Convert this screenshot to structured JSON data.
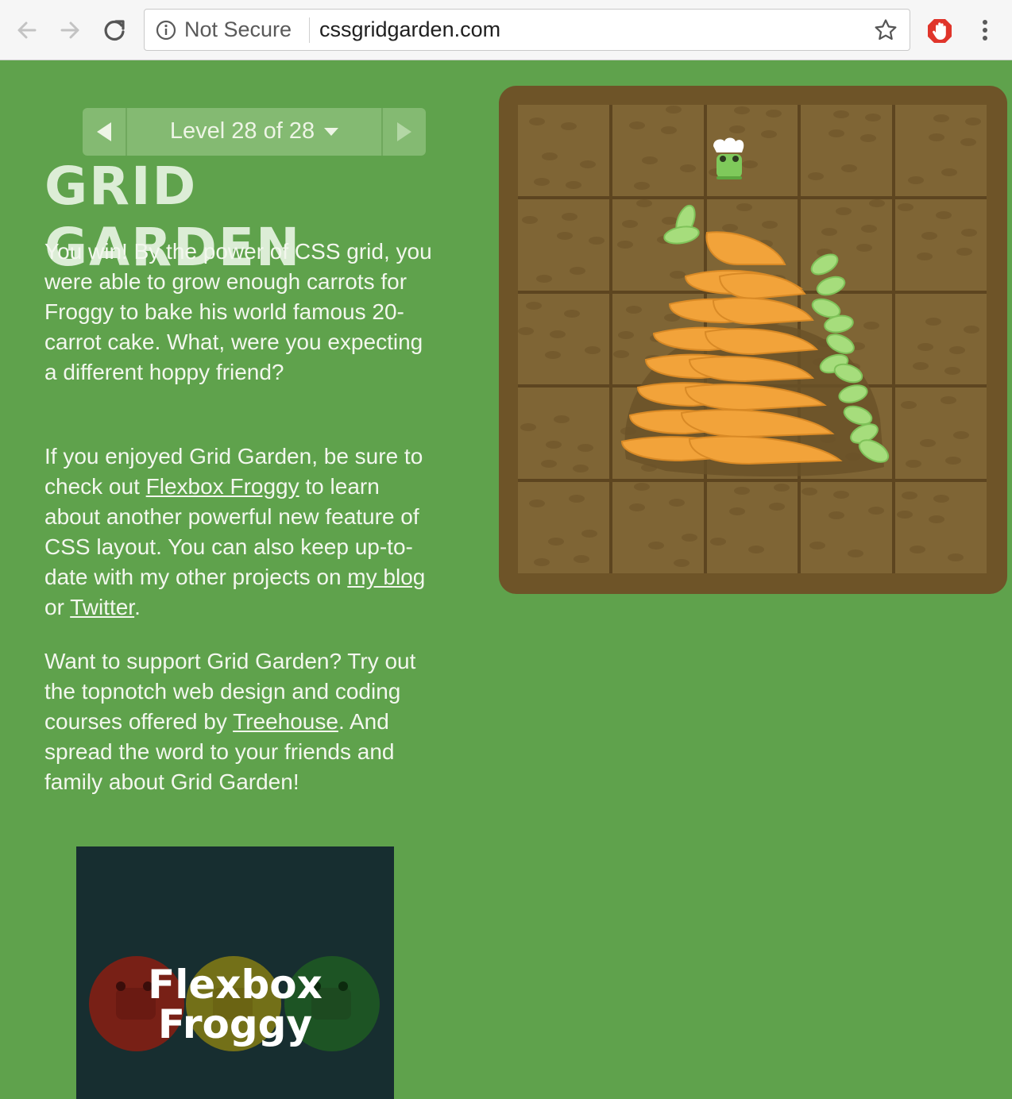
{
  "browser": {
    "security_label": "Not Secure",
    "url": "cssgridgarden.com",
    "icons": [
      "back-arrow-icon",
      "forward-arrow-icon",
      "reload-icon",
      "info-icon",
      "star-icon",
      "ublock-icon",
      "menu-icon"
    ]
  },
  "level": {
    "label": "Level 28 of 28"
  },
  "title": "GRID GARDEN",
  "paragraphs": {
    "p1": "You win! By the power of CSS grid, you were able to grow enough carrots for Froggy to bake his world famous 20-carrot cake. What, were you expecting a different hoppy friend?",
    "p2_a": "If you enjoyed Grid Garden, be sure to check out ",
    "p2_link1": "Flexbox Froggy",
    "p2_b": " to learn about another powerful new feature of CSS layout. You can also keep up-to-date with my other projects on ",
    "p2_link2": "my blog",
    "p2_c": " or ",
    "p2_link3": "Twitter",
    "p2_d": ".",
    "p3_a": "Want to support Grid Garden? Try out the topnotch web design and coding courses offered by ",
    "p3_link": "Treehouse",
    "p3_b": ". And spread the word to your friends and family about Grid Garden!"
  },
  "promo": {
    "line1": "Flexbox",
    "line2": "Froggy"
  },
  "colors": {
    "background": "#5fa24c",
    "soil": "#7f6535",
    "garden_border": "#6e5428",
    "carrot": "#f2a33a",
    "leaf": "#a6dd7c"
  }
}
